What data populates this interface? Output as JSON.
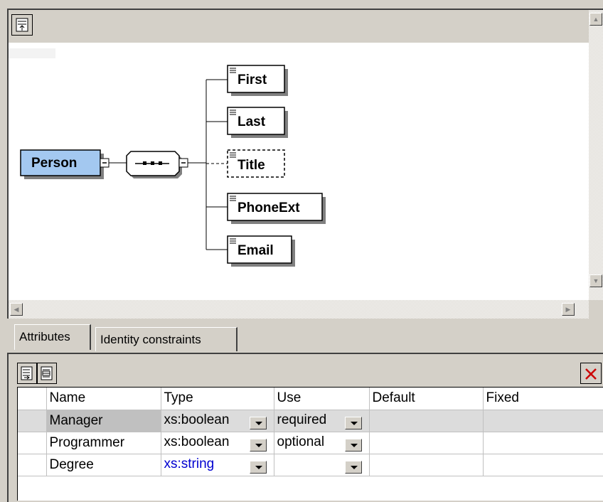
{
  "diagram": {
    "root": "Person",
    "children": [
      "First",
      "Last",
      "Title",
      "PhoneExt",
      "Email"
    ],
    "optional_child": "Title",
    "compositor": "sequence"
  },
  "tabs": [
    {
      "label": "Attributes",
      "active": true
    },
    {
      "label": "Identity constraints",
      "active": false
    }
  ],
  "attr_table": {
    "columns": [
      "Name",
      "Type",
      "Use",
      "Default",
      "Fixed"
    ],
    "rows": [
      {
        "name": "Manager",
        "type": "xs:boolean",
        "use": "required",
        "default": "",
        "fixed": "",
        "selected": true
      },
      {
        "name": "Programmer",
        "type": "xs:boolean",
        "use": "optional",
        "default": "",
        "fixed": ""
      },
      {
        "name": "Degree",
        "type": "xs:string",
        "use": "",
        "default": "",
        "fixed": ""
      }
    ]
  },
  "icons": {
    "diagram_toolbar": "display-mode-icon",
    "append_attribute": "append-attribute-icon",
    "insert_attribute": "insert-attribute-icon",
    "delete": "delete-x-icon"
  },
  "colors": {
    "root_fill": "#a3c8f0",
    "delete_red": "#cc0000",
    "type_link_blue": "#0000d0"
  }
}
